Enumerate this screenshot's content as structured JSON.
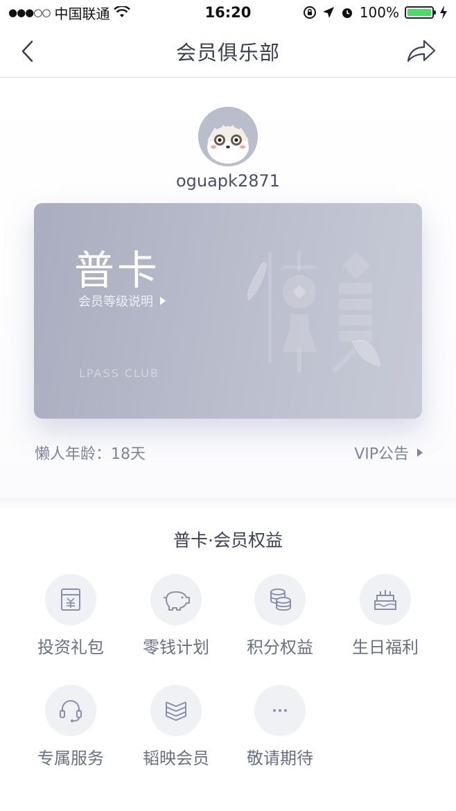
{
  "status_bar": {
    "carrier": "中国联通",
    "time": "16:20",
    "battery": "100%"
  },
  "nav": {
    "title": "会员俱乐部"
  },
  "profile": {
    "username": "oguapk2871"
  },
  "card": {
    "level": "普卡",
    "level_link": "会员等级说明",
    "club": "LPASS CLUB"
  },
  "info": {
    "age_label": "懒人年龄：",
    "age_value": "18天",
    "vip_link": "VIP公告"
  },
  "benefits": {
    "title": "普卡·会员权益",
    "items": [
      {
        "label": "投资礼包",
        "icon": "gift-card-icon"
      },
      {
        "label": "零钱计划",
        "icon": "piggy-bank-icon"
      },
      {
        "label": "积分权益",
        "icon": "coins-stack-icon"
      },
      {
        "label": "生日福利",
        "icon": "birthday-cake-icon"
      },
      {
        "label": "专属服务",
        "icon": "headset-icon"
      },
      {
        "label": "韬映会员",
        "icon": "layers-icon"
      },
      {
        "label": "敬请期待",
        "icon": "more-dots-icon"
      }
    ]
  },
  "colors": {
    "accent_text": "#7e839c",
    "card_start": "#a9adbf",
    "card_end": "#c7cad6",
    "icon_bg": "#f0f1f5",
    "battery_fill": "#4cd964"
  }
}
